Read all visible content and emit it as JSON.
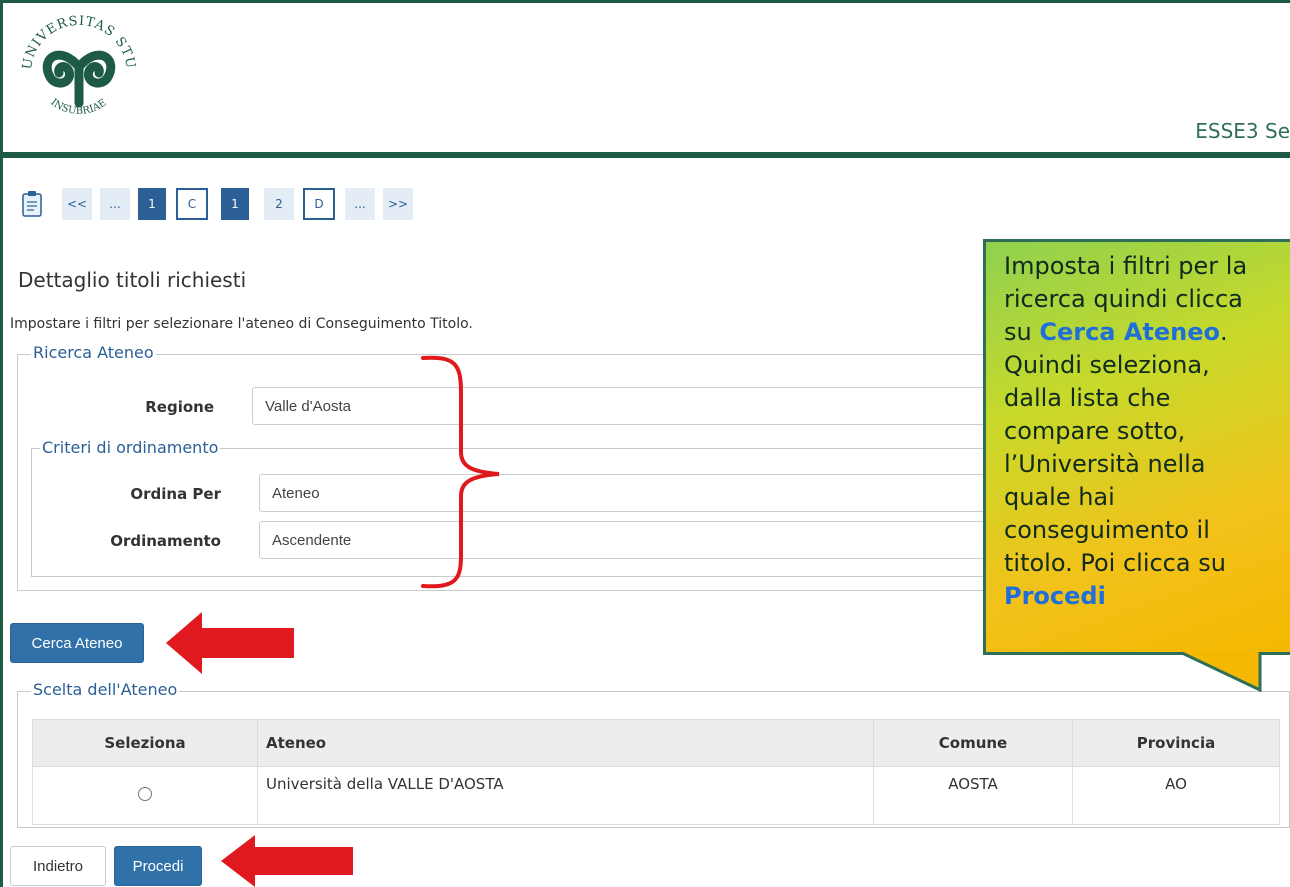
{
  "header": {
    "logo_text": "UNIVERSITAS STUDIORUM INSUBRIAE",
    "app_title": "ESSE3 Se"
  },
  "pager": {
    "items": [
      "<<",
      "...",
      "1",
      "C",
      "1",
      "2",
      "D",
      "...",
      ">>"
    ]
  },
  "page": {
    "title": "Dettaglio titoli richiesti",
    "intro": "Impostare i filtri per selezionare l'ateneo di Conseguimento Titolo."
  },
  "ricerca": {
    "legend": "Ricerca Ateneo",
    "regione_label": "Regione",
    "regione_value": "Valle d'Aosta",
    "criteri_legend": "Criteri di ordinamento",
    "ordina_per_label": "Ordina Per",
    "ordina_per_value": "Ateneo",
    "ordinamento_label": "Ordinamento",
    "ordinamento_value": "Ascendente"
  },
  "buttons": {
    "cerca": "Cerca Ateneo",
    "indietro": "Indietro",
    "procedi": "Procedi"
  },
  "scelta": {
    "legend": "Scelta dell'Ateneo",
    "headers": [
      "Seleziona",
      "Ateneo",
      "Comune",
      "Provincia"
    ],
    "rows": [
      {
        "ateneo": "Università della VALLE D'AOSTA",
        "comune": "AOSTA",
        "provincia": "AO"
      }
    ]
  },
  "callout": {
    "line1": "Imposta i filtri per la",
    "line2": "ricerca quindi clicca",
    "line3a": "su ",
    "line3b": "Cerca Ateneo",
    "line3c": ".",
    "line4": "Quindi seleziona,",
    "line5": "dalla lista che",
    "line6": "compare sotto,",
    "line7": "l’Università nella",
    "line8": "quale hai",
    "line9": "conseguimento il",
    "line10": "titolo. Poi clicca su",
    "line11": "Procedi"
  },
  "colors": {
    "brand_green": "#1e5b45",
    "link_blue": "#2b5f96",
    "button_blue": "#3071a9",
    "annotation_red": "#e0191f"
  }
}
